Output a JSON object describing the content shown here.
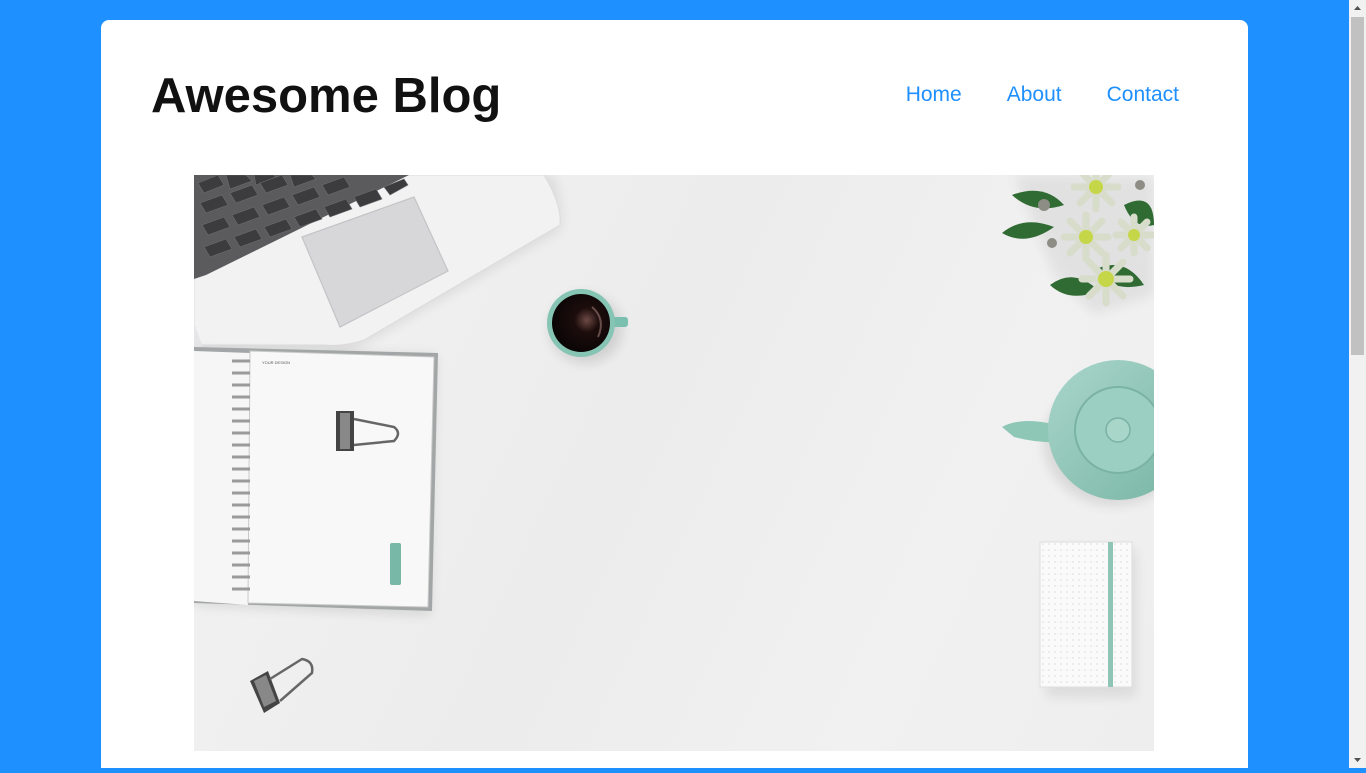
{
  "blog": {
    "title": "Awesome Blog"
  },
  "nav": {
    "items": [
      {
        "label": "Home"
      },
      {
        "label": "About"
      },
      {
        "label": "Contact"
      }
    ]
  },
  "hero": {
    "image": "desk-flatlay-image",
    "notebook_cover_text": "YOUR DESIGN"
  },
  "colors": {
    "page_background": "#1e90ff",
    "card_background": "#ffffff",
    "link": "#1e90ff",
    "title": "#111111",
    "accent_mint": "#8fc5b5"
  },
  "scrollbar": {
    "up_icon": "scroll-up-arrow-icon",
    "down_icon": "scroll-down-arrow-icon"
  }
}
